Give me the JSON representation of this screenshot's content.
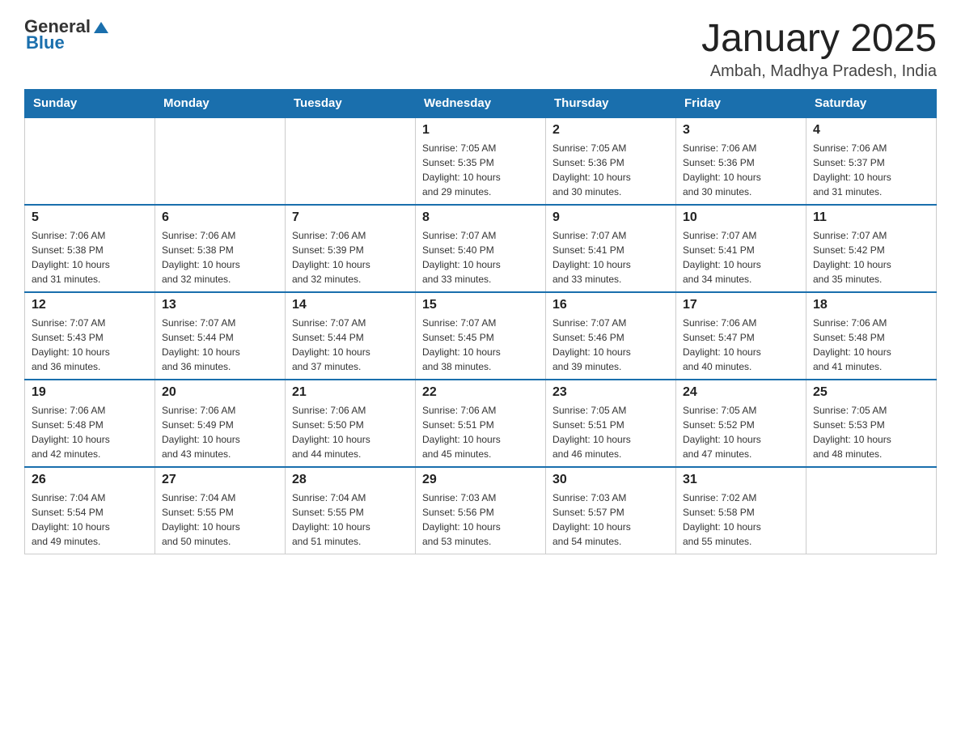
{
  "header": {
    "logo": {
      "general": "General",
      "blue": "Blue"
    },
    "title": "January 2025",
    "location": "Ambah, Madhya Pradesh, India"
  },
  "days_of_week": [
    "Sunday",
    "Monday",
    "Tuesday",
    "Wednesday",
    "Thursday",
    "Friday",
    "Saturday"
  ],
  "weeks": [
    [
      {
        "day": "",
        "info": ""
      },
      {
        "day": "",
        "info": ""
      },
      {
        "day": "",
        "info": ""
      },
      {
        "day": "1",
        "info": "Sunrise: 7:05 AM\nSunset: 5:35 PM\nDaylight: 10 hours\nand 29 minutes."
      },
      {
        "day": "2",
        "info": "Sunrise: 7:05 AM\nSunset: 5:36 PM\nDaylight: 10 hours\nand 30 minutes."
      },
      {
        "day": "3",
        "info": "Sunrise: 7:06 AM\nSunset: 5:36 PM\nDaylight: 10 hours\nand 30 minutes."
      },
      {
        "day": "4",
        "info": "Sunrise: 7:06 AM\nSunset: 5:37 PM\nDaylight: 10 hours\nand 31 minutes."
      }
    ],
    [
      {
        "day": "5",
        "info": "Sunrise: 7:06 AM\nSunset: 5:38 PM\nDaylight: 10 hours\nand 31 minutes."
      },
      {
        "day": "6",
        "info": "Sunrise: 7:06 AM\nSunset: 5:38 PM\nDaylight: 10 hours\nand 32 minutes."
      },
      {
        "day": "7",
        "info": "Sunrise: 7:06 AM\nSunset: 5:39 PM\nDaylight: 10 hours\nand 32 minutes."
      },
      {
        "day": "8",
        "info": "Sunrise: 7:07 AM\nSunset: 5:40 PM\nDaylight: 10 hours\nand 33 minutes."
      },
      {
        "day": "9",
        "info": "Sunrise: 7:07 AM\nSunset: 5:41 PM\nDaylight: 10 hours\nand 33 minutes."
      },
      {
        "day": "10",
        "info": "Sunrise: 7:07 AM\nSunset: 5:41 PM\nDaylight: 10 hours\nand 34 minutes."
      },
      {
        "day": "11",
        "info": "Sunrise: 7:07 AM\nSunset: 5:42 PM\nDaylight: 10 hours\nand 35 minutes."
      }
    ],
    [
      {
        "day": "12",
        "info": "Sunrise: 7:07 AM\nSunset: 5:43 PM\nDaylight: 10 hours\nand 36 minutes."
      },
      {
        "day": "13",
        "info": "Sunrise: 7:07 AM\nSunset: 5:44 PM\nDaylight: 10 hours\nand 36 minutes."
      },
      {
        "day": "14",
        "info": "Sunrise: 7:07 AM\nSunset: 5:44 PM\nDaylight: 10 hours\nand 37 minutes."
      },
      {
        "day": "15",
        "info": "Sunrise: 7:07 AM\nSunset: 5:45 PM\nDaylight: 10 hours\nand 38 minutes."
      },
      {
        "day": "16",
        "info": "Sunrise: 7:07 AM\nSunset: 5:46 PM\nDaylight: 10 hours\nand 39 minutes."
      },
      {
        "day": "17",
        "info": "Sunrise: 7:06 AM\nSunset: 5:47 PM\nDaylight: 10 hours\nand 40 minutes."
      },
      {
        "day": "18",
        "info": "Sunrise: 7:06 AM\nSunset: 5:48 PM\nDaylight: 10 hours\nand 41 minutes."
      }
    ],
    [
      {
        "day": "19",
        "info": "Sunrise: 7:06 AM\nSunset: 5:48 PM\nDaylight: 10 hours\nand 42 minutes."
      },
      {
        "day": "20",
        "info": "Sunrise: 7:06 AM\nSunset: 5:49 PM\nDaylight: 10 hours\nand 43 minutes."
      },
      {
        "day": "21",
        "info": "Sunrise: 7:06 AM\nSunset: 5:50 PM\nDaylight: 10 hours\nand 44 minutes."
      },
      {
        "day": "22",
        "info": "Sunrise: 7:06 AM\nSunset: 5:51 PM\nDaylight: 10 hours\nand 45 minutes."
      },
      {
        "day": "23",
        "info": "Sunrise: 7:05 AM\nSunset: 5:51 PM\nDaylight: 10 hours\nand 46 minutes."
      },
      {
        "day": "24",
        "info": "Sunrise: 7:05 AM\nSunset: 5:52 PM\nDaylight: 10 hours\nand 47 minutes."
      },
      {
        "day": "25",
        "info": "Sunrise: 7:05 AM\nSunset: 5:53 PM\nDaylight: 10 hours\nand 48 minutes."
      }
    ],
    [
      {
        "day": "26",
        "info": "Sunrise: 7:04 AM\nSunset: 5:54 PM\nDaylight: 10 hours\nand 49 minutes."
      },
      {
        "day": "27",
        "info": "Sunrise: 7:04 AM\nSunset: 5:55 PM\nDaylight: 10 hours\nand 50 minutes."
      },
      {
        "day": "28",
        "info": "Sunrise: 7:04 AM\nSunset: 5:55 PM\nDaylight: 10 hours\nand 51 minutes."
      },
      {
        "day": "29",
        "info": "Sunrise: 7:03 AM\nSunset: 5:56 PM\nDaylight: 10 hours\nand 53 minutes."
      },
      {
        "day": "30",
        "info": "Sunrise: 7:03 AM\nSunset: 5:57 PM\nDaylight: 10 hours\nand 54 minutes."
      },
      {
        "day": "31",
        "info": "Sunrise: 7:02 AM\nSunset: 5:58 PM\nDaylight: 10 hours\nand 55 minutes."
      },
      {
        "day": "",
        "info": ""
      }
    ]
  ]
}
